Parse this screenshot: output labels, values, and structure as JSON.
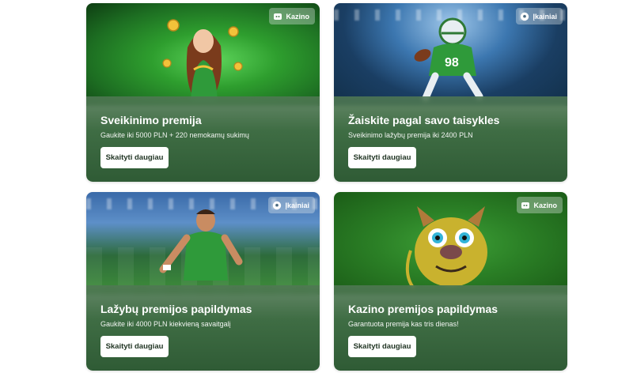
{
  "cards": [
    {
      "badge": {
        "label": "Kazino",
        "icon": "casino-chip-icon"
      },
      "title": "Sveikinimo premija",
      "subtitle": "Gaukite iki 5000 PLN + 220 nemokamų sukimų",
      "button": "Skaityti daugiau"
    },
    {
      "badge": {
        "label": "Įkainiai",
        "icon": "soccer-ball-icon"
      },
      "title": "Žaiskite pagal savo taisykles",
      "subtitle": "Sveikinimo lažybų premija iki 2400 PLN",
      "button": "Skaityti daugiau"
    },
    {
      "badge": {
        "label": "Įkainiai",
        "icon": "soccer-ball-icon"
      },
      "title": "Lažybų premijos papildymas",
      "subtitle": "Gaukite iki 4000 PLN kiekvieną savaitgalį",
      "button": "Skaityti daugiau"
    },
    {
      "badge": {
        "label": "Kazino",
        "icon": "casino-chip-icon"
      },
      "title": "Kazino premijos papildymas",
      "subtitle": "Garantuota premija kas tris dienas!",
      "button": "Skaityti daugiau"
    }
  ]
}
